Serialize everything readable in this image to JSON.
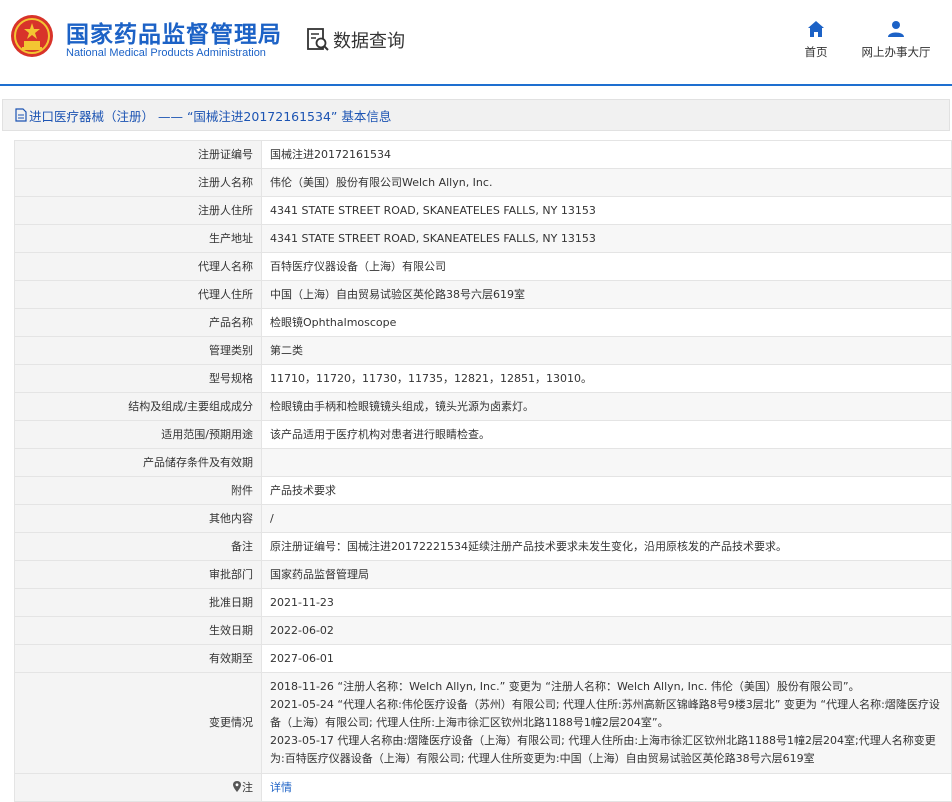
{
  "header": {
    "logo_cn": "国家药品监督管理局",
    "logo_en": "National Medical Products Administration",
    "query_label": "数据查询",
    "nav": [
      {
        "label": "首页",
        "icon": "home-icon"
      },
      {
        "label": "网上办事大厅",
        "icon": "user-icon"
      }
    ]
  },
  "colors": {
    "brand_blue": "#1c62c6",
    "header_line": "#1e6fd0",
    "label_bg": "#f4f4f4"
  },
  "title_bar": {
    "text": "进口医疗器械（注册） —— “国械注进20172161534” 基本信息"
  },
  "rows": [
    {
      "label": "注册证编号",
      "value": "国械注进20172161534"
    },
    {
      "label": "注册人名称",
      "value": "伟伦（美国）股份有限公司Welch Allyn, Inc."
    },
    {
      "label": "注册人住所",
      "value": "4341 STATE STREET ROAD, SKANEATELES FALLS, NY 13153"
    },
    {
      "label": "生产地址",
      "value": "4341 STATE STREET ROAD, SKANEATELES FALLS, NY 13153"
    },
    {
      "label": "代理人名称",
      "value": "百特医疗仪器设备（上海）有限公司"
    },
    {
      "label": "代理人住所",
      "value": "中国（上海）自由贸易试验区英伦路38号六层619室"
    },
    {
      "label": "产品名称",
      "value": "检眼镜Ophthalmoscope"
    },
    {
      "label": "管理类别",
      "value": "第二类"
    },
    {
      "label": "型号规格",
      "value": "11710，11720，11730，11735，12821，12851，13010。"
    },
    {
      "label": "结构及组成/主要组成成分",
      "value": "检眼镜由手柄和检眼镜镜头组成，镜头光源为卤素灯。"
    },
    {
      "label": "适用范围/预期用途",
      "value": "该产品适用于医疗机构对患者进行眼睛检查。"
    },
    {
      "label": "产品储存条件及有效期",
      "value": ""
    },
    {
      "label": "附件",
      "value": "产品技术要求"
    },
    {
      "label": "其他内容",
      "value": "/"
    },
    {
      "label": "备注",
      "value": "原注册证编号：国械注进20172221534延续注册产品技术要求未发生变化，沿用原核发的产品技术要求。"
    },
    {
      "label": "审批部门",
      "value": "国家药品监督管理局"
    },
    {
      "label": "批准日期",
      "value": "2021-11-23"
    },
    {
      "label": "生效日期",
      "value": "2022-06-02"
    },
    {
      "label": "有效期至",
      "value": "2027-06-01"
    }
  ],
  "changes": {
    "label": "变更情况",
    "lines": [
      "2018-11-26 “注册人名称：Welch Allyn, Inc.” 变更为 “注册人名称：Welch Allyn, Inc. 伟伦（美国）股份有限公司”。",
      "2021-05-24 “代理人名称:伟伦医疗设备（苏州）有限公司; 代理人住所:苏州高新区锦峰路8号9楼3层北” 变更为 “代理人名称:熠隆医疗设备（上海）有限公司; 代理人住所:上海市徐汇区钦州北路1188号1幢2层204室”。",
      "2023-05-17 代理人名称由:熠隆医疗设备（上海）有限公司; 代理人住所由:上海市徐汇区钦州北路1188号1幢2层204室;代理人名称变更为:百特医疗仪器设备（上海）有限公司; 代理人住所变更为:中国（上海）自由贸易试验区英伦路38号六层619室"
    ]
  },
  "note": {
    "label": "注",
    "link": "详情",
    "icon": "pin-icon"
  }
}
